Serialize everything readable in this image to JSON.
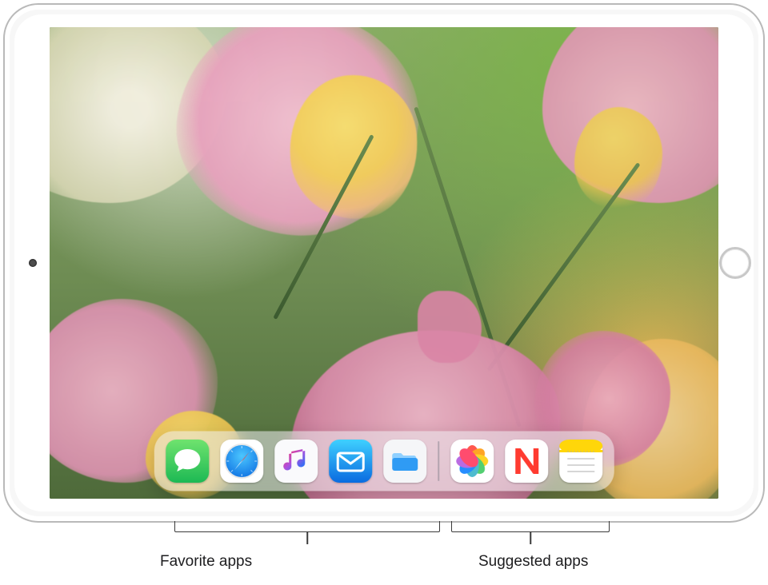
{
  "dock": {
    "favorites": [
      {
        "name": "Messages",
        "id": "messages"
      },
      {
        "name": "Safari",
        "id": "safari"
      },
      {
        "name": "Music",
        "id": "music"
      },
      {
        "name": "Mail",
        "id": "mail"
      },
      {
        "name": "Files",
        "id": "files"
      }
    ],
    "suggested": [
      {
        "name": "Photos",
        "id": "photos"
      },
      {
        "name": "News",
        "id": "news"
      },
      {
        "name": "Notes",
        "id": "notes"
      }
    ]
  },
  "callouts": {
    "favorites_label": "Favorite apps",
    "suggested_label": "Suggested apps"
  },
  "wallpaper_description": "Close-up photo of pink and yellow snapdragon flowers with blurred green foliage"
}
